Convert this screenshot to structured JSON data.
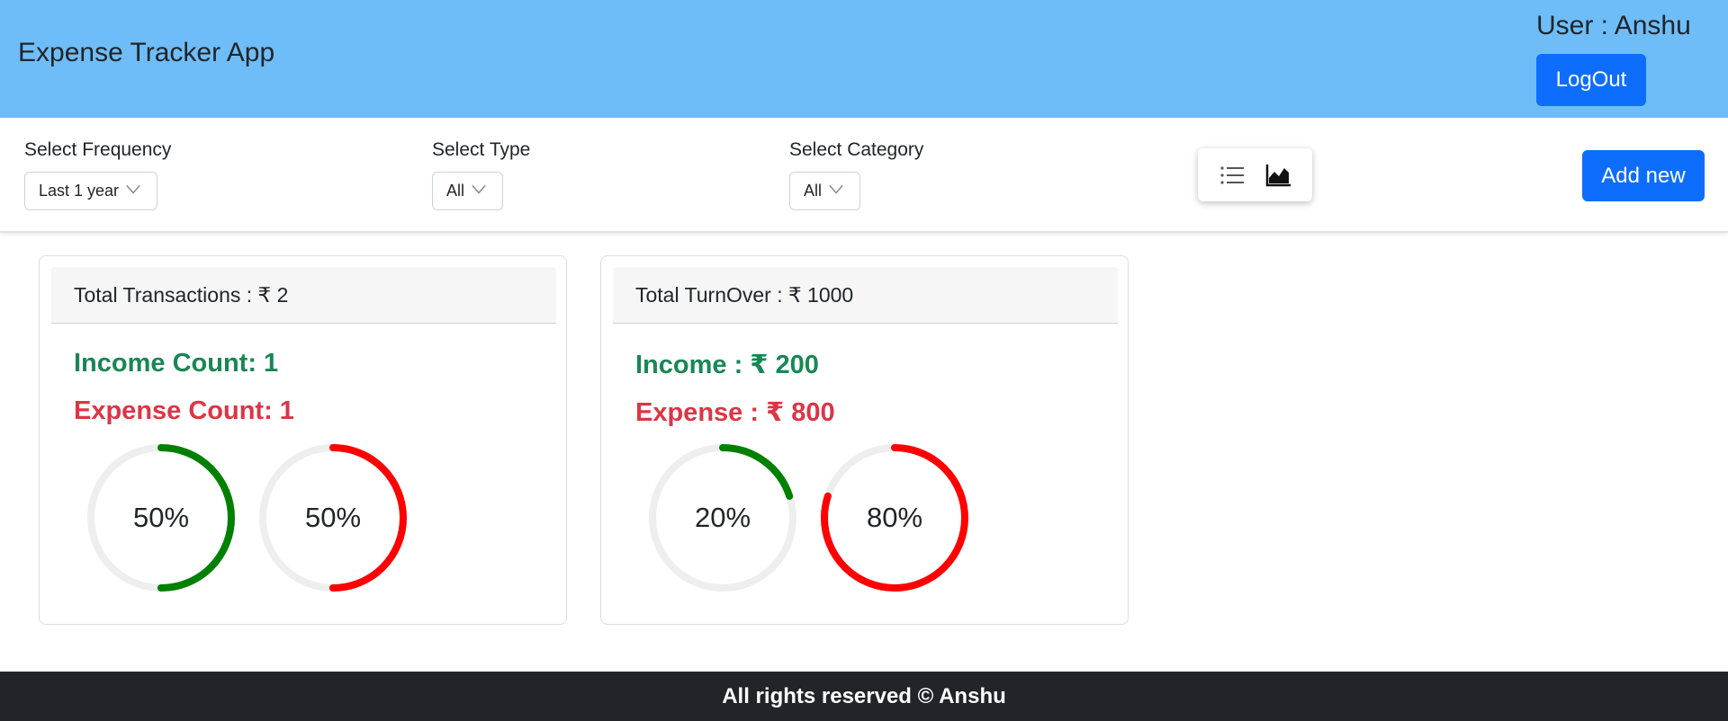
{
  "header": {
    "title": "Expense Tracker App",
    "user_label": "User : Anshu",
    "logout_label": "LogOut",
    "background": "#6fbdf8"
  },
  "filters": {
    "frequency_label": "Select Frequency",
    "frequency_value": "Last 1 year",
    "type_label": "Select Type",
    "type_value": "All",
    "category_label": "Select Category",
    "category_value": "All",
    "view_icons": [
      "list-view-icon",
      "chart-view-icon"
    ],
    "add_label": "Add new",
    "accent": "#0d6efd"
  },
  "transactions_card": {
    "header": "Total Transactions : ₹ 2",
    "income_line": "Income Count: 1",
    "expense_line": "Expense Count: 1",
    "income_percent": 50,
    "income_percent_label": "50%",
    "expense_percent": 50,
    "expense_percent_label": "50%"
  },
  "turnover_card": {
    "header": "Total TurnOver : ₹ 1000",
    "income_line": "Income : ₹ 200",
    "expense_line": "Expense : ₹ 800",
    "income_percent": 20,
    "income_percent_label": "20%",
    "expense_percent": 80,
    "expense_percent_label": "80%"
  },
  "colors": {
    "income": "#198754",
    "expense": "#dc3545",
    "ring_income": "#008000",
    "ring_expense": "#ff0000",
    "ring_track": "#eeeeee"
  },
  "footer": {
    "text": "All rights reserved © Anshu"
  }
}
